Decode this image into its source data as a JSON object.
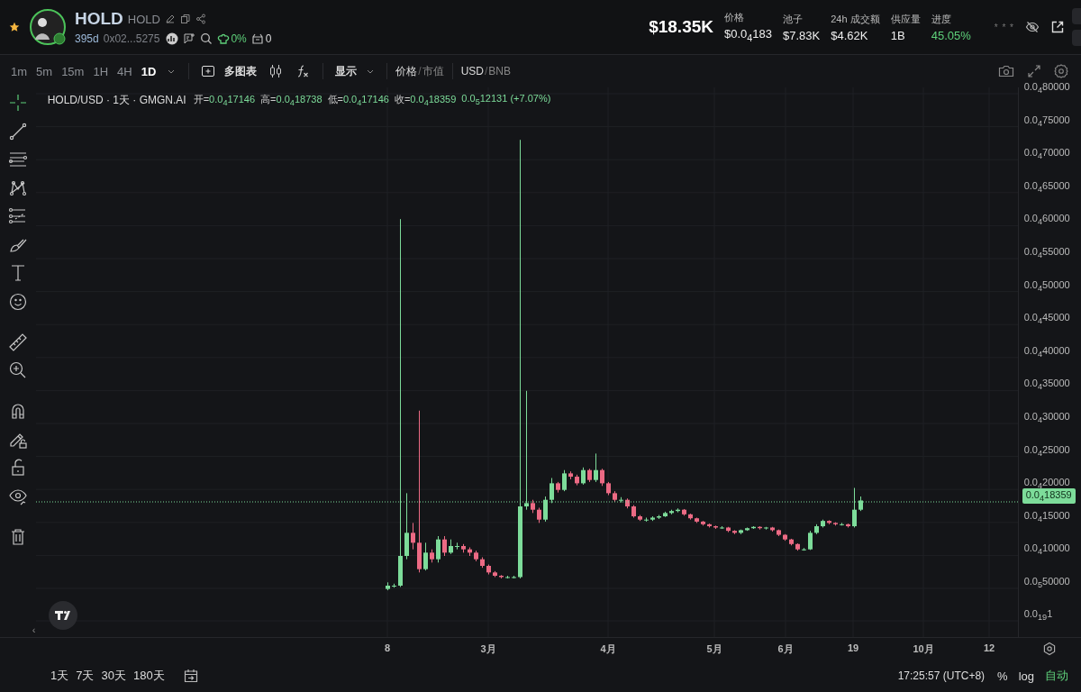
{
  "token": {
    "name": "HOLD",
    "ticker": "HOLD",
    "favorite": true,
    "age": "395d",
    "address": "0x02...5275",
    "holders_pct": "0%",
    "count": "0"
  },
  "market_cap": "$18.35K",
  "stats": [
    {
      "label": "价格",
      "value": "$0.0$_{4}$183",
      "highlighted": false
    },
    {
      "label": "池子",
      "value": "$7.83K",
      "highlighted": false
    },
    {
      "label": "24h 成交额",
      "value": "$4.62K",
      "highlighted": false
    },
    {
      "label": "供应量",
      "value": "1B",
      "highlighted": false
    },
    {
      "label": "进度",
      "value": "45.05%",
      "highlighted": true
    }
  ],
  "masked": "* * *",
  "intervals": [
    {
      "label": "1m",
      "selected": false
    },
    {
      "label": "5m",
      "selected": false
    },
    {
      "label": "15m",
      "selected": false
    },
    {
      "label": "1H",
      "selected": false
    },
    {
      "label": "4H",
      "selected": false
    },
    {
      "label": "1D",
      "selected": true
    }
  ],
  "multi_chart": "多图表",
  "display": "显示",
  "value_mode_separator": "/",
  "currency_separator": "/",
  "value_mode": [
    {
      "label": "价格",
      "selected": true
    },
    {
      "label": "市值",
      "selected": false
    }
  ],
  "currency": [
    {
      "label": "USD",
      "selected": true
    },
    {
      "label": "BNB",
      "selected": false
    }
  ],
  "tools": [
    {
      "kind": "crosshair",
      "selected": true
    },
    {
      "kind": "line",
      "selected": false
    },
    {
      "kind": "channel",
      "selected": false
    },
    {
      "kind": "pattern",
      "selected": false
    },
    {
      "kind": "fib",
      "selected": false
    },
    {
      "kind": "brush",
      "selected": false
    },
    {
      "kind": "text",
      "selected": false
    },
    {
      "kind": "emoji",
      "selected": false
    },
    {
      "kind": "ruler",
      "selected": false
    },
    {
      "kind": "zoom",
      "selected": false
    },
    {
      "kind": "magnet",
      "selected": false
    },
    {
      "kind": "lock-draw",
      "selected": false
    },
    {
      "kind": "lock",
      "selected": false
    },
    {
      "kind": "eye",
      "selected": false
    },
    {
      "kind": "trash",
      "selected": false
    }
  ],
  "legend": {
    "title": "HOLD/USD · 1天 · GMGN.AI",
    "ohlc": [
      {
        "label": "开=",
        "value": "0.0$_{4}$17146"
      },
      {
        "label": "高=",
        "value": "0.0$_{4}$18738"
      },
      {
        "label": "低=",
        "value": "0.0$_{4}$17146"
      },
      {
        "label": "收=",
        "value": "0.0$_{4}$18359"
      }
    ],
    "change": "0.0$_{5}$12131 (+7.07%)"
  },
  "price_axis": [
    "0.0$_{4}$80000",
    "0.0$_{4}$75000",
    "0.0$_{4}$70000",
    "0.0$_{4}$65000",
    "0.0$_{4}$60000",
    "0.0$_{4}$55000",
    "0.0$_{4}$50000",
    "0.0$_{4}$45000",
    "0.0$_{4}$40000",
    "0.0$_{4}$35000",
    "0.0$_{4}$30000",
    "0.0$_{4}$25000",
    "0.0$_{4}$20000",
    "0.0$_{4}$15000",
    "0.0$_{4}$10000",
    "0.0$_{5}$50000",
    "0.0$_{19}$1"
  ],
  "current_price": "0.0$_{4}$18359",
  "time_axis": [
    "8",
    "3月",
    "4月",
    "5月",
    "6月",
    "19",
    "10月",
    "12"
  ],
  "scroll_left": "‹",
  "ranges": [
    "1天",
    "7天",
    "30天",
    "180天"
  ],
  "clock": "17:25:57 (UTC+8)",
  "scale": [
    {
      "label": "%",
      "selected": false
    },
    {
      "label": "log",
      "selected": false
    },
    {
      "label": "自动",
      "selected": true
    }
  ]
}
